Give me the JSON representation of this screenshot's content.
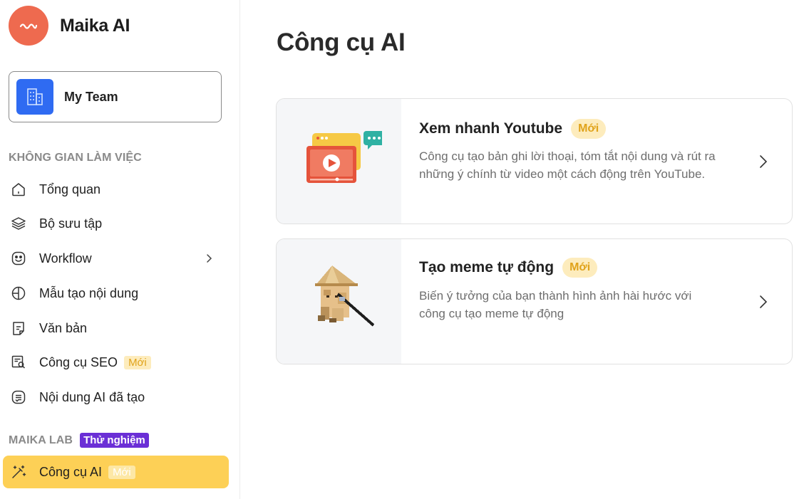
{
  "brand": {
    "name": "Maika AI"
  },
  "team": {
    "name": "My Team"
  },
  "workspace": {
    "section_label": "KHÔNG GIAN LÀM VIỆC",
    "items": [
      {
        "label": "Tổng quan",
        "icon": "home-icon"
      },
      {
        "label": "Bộ sưu tập",
        "icon": "layers-icon"
      },
      {
        "label": "Workflow",
        "icon": "smile-box-icon"
      },
      {
        "label": "Mẫu tạo nội dung",
        "icon": "grid-circle-icon"
      },
      {
        "label": "Văn bản",
        "icon": "document-icon"
      },
      {
        "label": "Công cụ SEO",
        "icon": "seo-search-icon",
        "badge": "Mới"
      },
      {
        "label": "Nội dung AI đã tạo",
        "icon": "ai-content-icon"
      }
    ]
  },
  "lab": {
    "section_label": "MAIKA LAB",
    "badge": "Thử nghiệm",
    "items": [
      {
        "label": "Công cụ AI",
        "icon": "magic-wand-icon",
        "badge": "Mới",
        "active": true
      }
    ]
  },
  "main": {
    "title": "Công cụ AI",
    "tools": [
      {
        "title": "Xem nhanh Youtube",
        "badge": "Mới",
        "description": "Công cụ tạo bản ghi lời thoại, tóm tắt nội dung và rút ra những ý chính từ video một cách động trên YouTube.",
        "icon": "youtube-video-illustration"
      },
      {
        "title": "Tạo meme tự động",
        "badge": "Mới",
        "description": "Biến ý tưởng của bạn thành hình ảnh hài hước với công cụ tạo meme tự động",
        "icon": "meme-cat-illustration"
      }
    ]
  },
  "colors": {
    "brand": "#ee6a4f",
    "active_nav": "#fdd056",
    "badge_bg": "#fdecbd",
    "badge_text": "#e0a31b",
    "lab_badge": "#6b2fd6",
    "team_icon": "#2f6bf2"
  }
}
